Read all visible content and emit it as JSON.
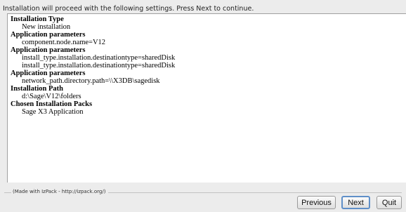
{
  "intro_text": "Installation will proceed with the following settings. Press Next to continue.",
  "summary": [
    {
      "title": "Installation Type",
      "lines": [
        "New installation"
      ]
    },
    {
      "title": "Application parameters",
      "lines": [
        "component.node.name=V12"
      ]
    },
    {
      "title": "Application parameters",
      "lines": [
        "install_type.installation.destinationtype=sharedDisk",
        "install_type.installation.destinationtype=sharedDisk"
      ]
    },
    {
      "title": "Application parameters",
      "lines": [
        "network_path.directory.path=\\\\X3DB\\sagedisk"
      ]
    },
    {
      "title": "Installation Path",
      "lines": [
        "d:\\Sage\\V12\\folders"
      ]
    },
    {
      "title": "Chosen Installation Packs",
      "lines": [
        "Sage X3 Application"
      ]
    }
  ],
  "footer": {
    "credit": "(Made with IzPack - http://izpack.org/)"
  },
  "buttons": {
    "previous": "Previous",
    "next": "Next",
    "quit": "Quit"
  }
}
